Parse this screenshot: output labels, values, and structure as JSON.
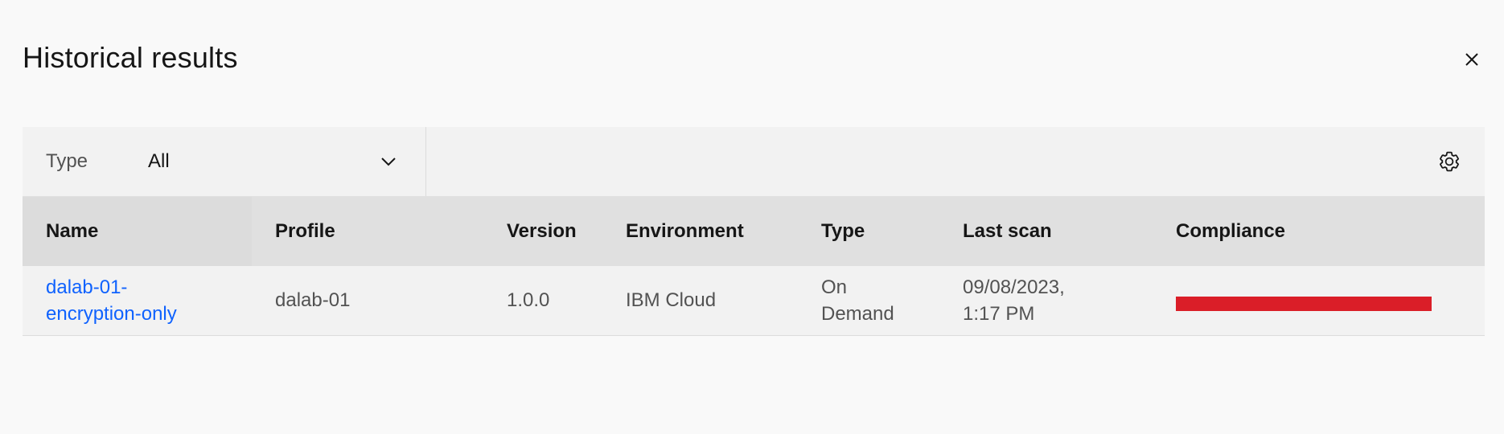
{
  "modal": {
    "title": "Historical results"
  },
  "icons": {
    "close": "close-icon",
    "chevron": "chevron-down-icon",
    "settings": "gear-icon"
  },
  "toolbar": {
    "filter_label": "Type",
    "filter_value": "All"
  },
  "table": {
    "columns": [
      "Name",
      "Profile",
      "Version",
      "Environment",
      "Type",
      "Last scan",
      "Compliance"
    ],
    "rows": [
      {
        "name_line1": "dalab-01-",
        "name_line2": "encryption-only",
        "profile": "dalab-01",
        "version": "1.0.0",
        "environment": "IBM Cloud",
        "type_line1": "On",
        "type_line2": "Demand",
        "last_scan_line1": "09/08/2023,",
        "last_scan_line2": "1:17 PM",
        "compliance_color": "#da1e28"
      }
    ]
  },
  "colors": {
    "link": "#0f62fe",
    "failed": "#da1e28",
    "header_bg": "#e0e0e0",
    "row_bg": "#f2f2f2"
  }
}
